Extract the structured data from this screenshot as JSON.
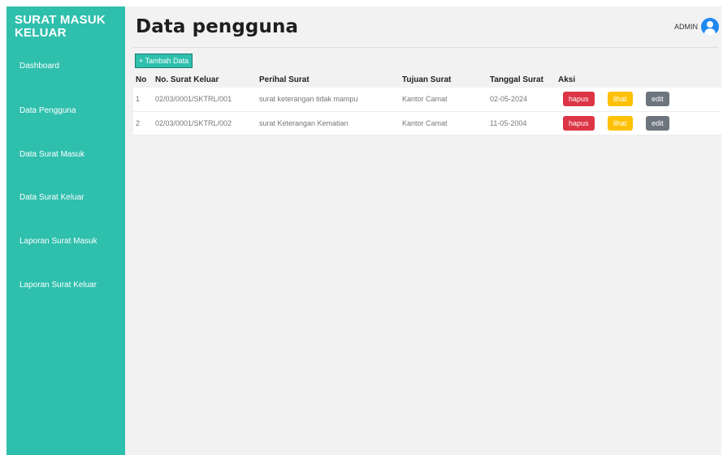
{
  "sidebar": {
    "brand": "SURAT MASUK KELUAR",
    "items": [
      {
        "label": "Dashboard"
      },
      {
        "label": "Data Pengguna"
      },
      {
        "label": "Data Surat Masuk"
      },
      {
        "label": "Data Surat Keluar"
      },
      {
        "label": "Laporan Surat Masuk"
      },
      {
        "label": "Laporan Surat Keluar"
      }
    ]
  },
  "header": {
    "title": "Data pengguna",
    "user": "ADMIN",
    "avatar_icon": "user-circle-icon"
  },
  "toolbar": {
    "add_label": "+ Tambah Data"
  },
  "table": {
    "columns": [
      "No",
      "No. Surat Keluar",
      "Perihal Surat",
      "Tujuan Surat",
      "Tanggal Surat",
      "Aksi"
    ],
    "rows": [
      {
        "no": "1",
        "nomor": "02/03/0001/SKTRL/001",
        "perihal": "surat keterangan tidak mampu",
        "tujuan": "Kantor Camat",
        "tanggal": "02-05-2024"
      },
      {
        "no": "2",
        "nomor": "02/03/0001/SKTRL/002",
        "perihal": "surat Keterangan Kematian",
        "tujuan": "Kantor Camat",
        "tanggal": "11-05-2004"
      }
    ],
    "actions": {
      "delete": "hapus",
      "view": "lihat",
      "edit": "edit"
    }
  },
  "colors": {
    "sidebar": "#2fbfad",
    "danger": "#dc3545",
    "warning": "#ffc107",
    "secondary": "#6c757d",
    "avatar": "#1f87f2"
  }
}
